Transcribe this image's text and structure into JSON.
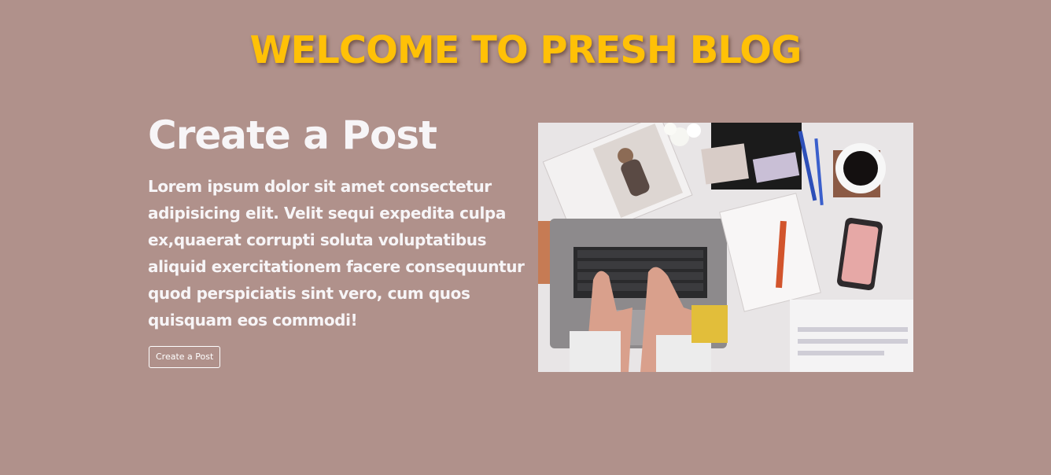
{
  "header": {
    "title": "WELCOME TO PRESH BLOG",
    "title_color": "#ffc107"
  },
  "hero": {
    "heading": "Create a Post",
    "body": "Lorem ipsum dolor sit amet consectetur adipisicing elit. Velit sequi expedita culpa ex,quaerat corrupti soluta voluptatibus aliquid exercitationem facere consequuntur quod perspiciatis sint vero, cum quos quisquam eos commodi!",
    "button_label": "Create a Post",
    "image_icon": "laptop-desk-photo"
  },
  "colors": {
    "background": "#b0918b",
    "text": "#f7f5f7"
  }
}
